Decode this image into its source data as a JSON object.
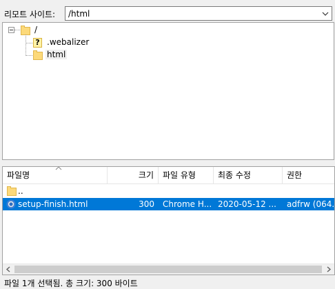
{
  "remote_site": {
    "label": "리모트 사이트:",
    "path": "/html"
  },
  "tree": {
    "root": "/",
    "children": [
      {
        "name": ".webalizer",
        "icon": "question-folder-icon"
      },
      {
        "name": "html",
        "icon": "folder-icon"
      }
    ]
  },
  "file_list": {
    "columns": [
      "파일명",
      "크기",
      "파일 유형",
      "최종 수정",
      "권한"
    ],
    "rows": [
      {
        "name": "..",
        "size": "",
        "type": "",
        "modified": "",
        "perms": "",
        "selected": false,
        "icon": "folder-icon"
      },
      {
        "name": "setup-finish.html",
        "size": "300",
        "type": "Chrome H...",
        "modified": "2020-05-12 ...",
        "perms": "adfrw (064...",
        "selected": true,
        "icon": "chrome-icon"
      }
    ]
  },
  "status": {
    "text": "파일 1개 선택됨. 총 크기: 300 바이트"
  },
  "colors": {
    "selection": "#0078d7",
    "folder": "#fcd97a"
  }
}
